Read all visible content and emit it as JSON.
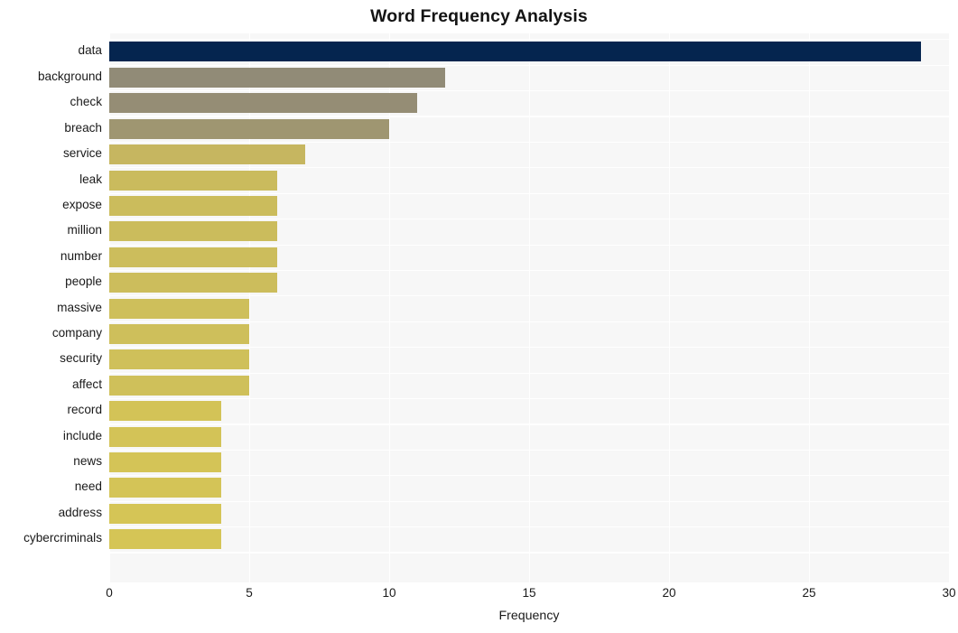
{
  "chart_data": {
    "type": "bar",
    "orientation": "horizontal",
    "title": "Word Frequency Analysis",
    "xlabel": "Frequency",
    "ylabel": "",
    "xlim": [
      0,
      30
    ],
    "xticks": [
      0,
      5,
      10,
      15,
      20,
      25,
      30
    ],
    "xticklabels": [
      "0",
      "5",
      "10",
      "15",
      "20",
      "25",
      "30"
    ],
    "grid": true,
    "legend": false,
    "categories": [
      "data",
      "background",
      "check",
      "breach",
      "service",
      "leak",
      "expose",
      "million",
      "number",
      "people",
      "massive",
      "company",
      "security",
      "affect",
      "record",
      "include",
      "news",
      "need",
      "address",
      "cybercriminals"
    ],
    "values": [
      29,
      12,
      11,
      10,
      7,
      6,
      6,
      6,
      6,
      6,
      5,
      5,
      5,
      5,
      4,
      4,
      4,
      4,
      4,
      4
    ],
    "bar_colors": [
      "#05254f",
      "#918b77",
      "#958d75",
      "#9f9671",
      "#c6b660",
      "#cabb5d",
      "#cbbc5c",
      "#cbbc5c",
      "#ccbd5c",
      "#ccbd5c",
      "#cebf5b",
      "#cebf5b",
      "#cfc05a",
      "#cfc05a",
      "#d3c357",
      "#d3c357",
      "#d4c457",
      "#d4c457",
      "#d5c556",
      "#d5c556"
    ]
  },
  "style": {
    "figure_background": "#ffffff",
    "axes_background": "#f7f7f7",
    "grid_color": "#ffffff",
    "text_color": "#1a1a1a",
    "title_color": "#141414"
  }
}
